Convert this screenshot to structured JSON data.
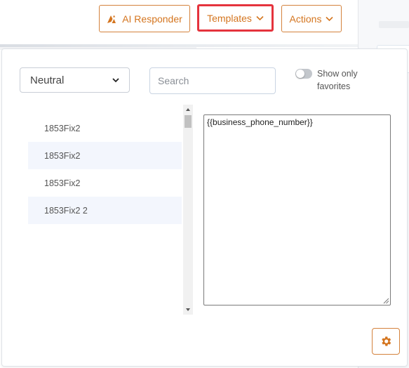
{
  "toolbar": {
    "ai_responder_label": "AI Responder",
    "templates_label": "Templates",
    "actions_label": "Actions"
  },
  "templates_popup": {
    "tone_select": {
      "selected": "Neutral"
    },
    "search": {
      "placeholder": "Search",
      "value": ""
    },
    "favorites_toggle": {
      "label": "Show only favorites",
      "checked": false
    },
    "template_items": [
      {
        "label": "1853Fix2"
      },
      {
        "label": "1853Fix2"
      },
      {
        "label": "1853Fix2"
      },
      {
        "label": "1853Fix2 2"
      }
    ],
    "preview_text": "{{business_phone_number}}"
  },
  "colors": {
    "accent": "#d4751f",
    "highlight_outline": "#e5333d",
    "list_alt_row": "#f3f6fd"
  },
  "icons": {
    "ai": "ai-logo-icon",
    "chevron": "chevron-down-icon",
    "settings": "gear-icon"
  }
}
